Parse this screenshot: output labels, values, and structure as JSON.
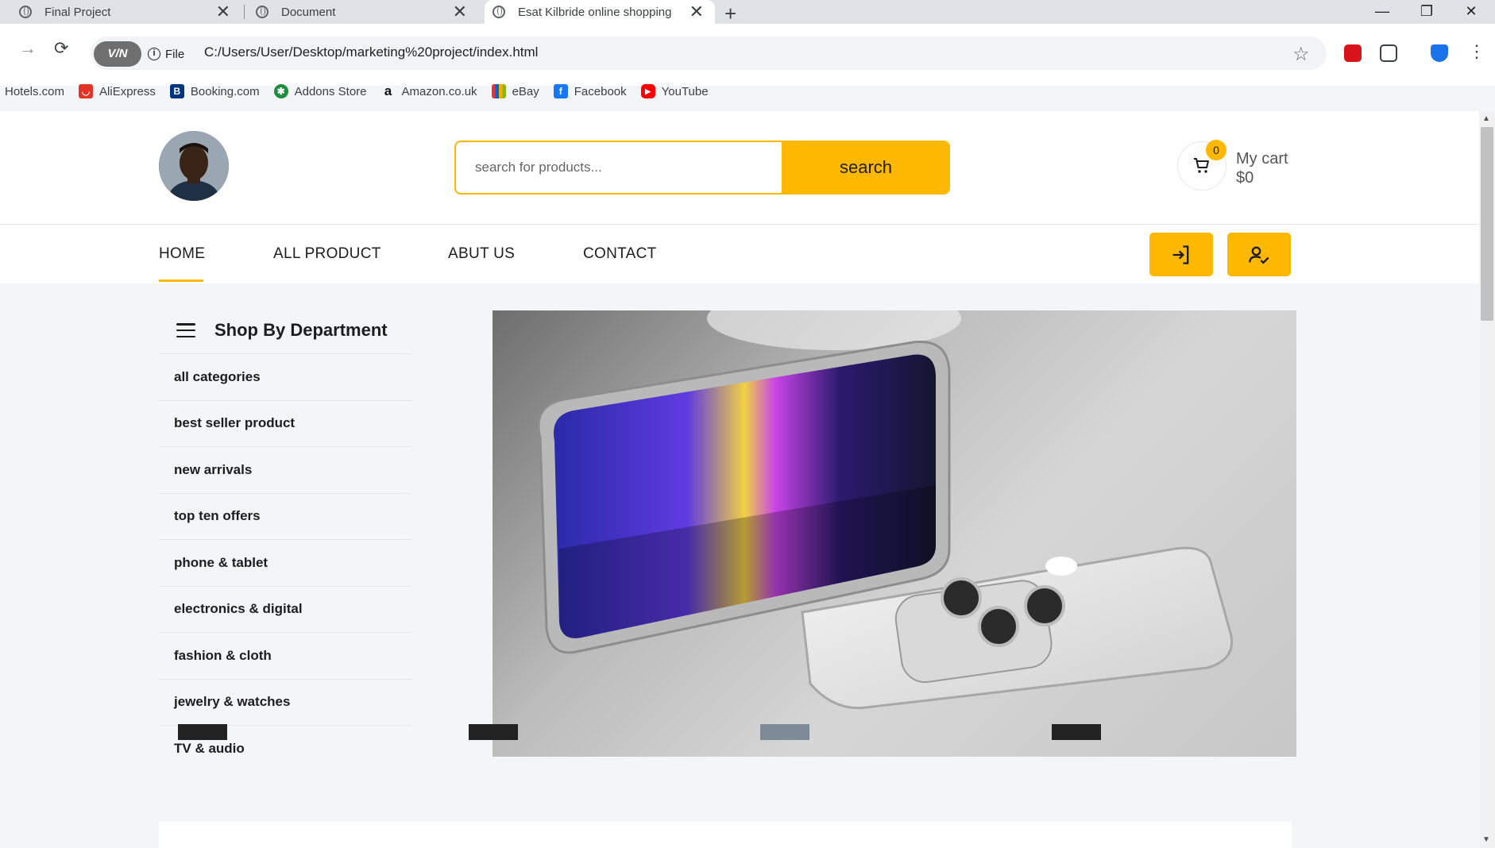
{
  "browser": {
    "tabs": [
      {
        "title": "Final Project",
        "active": false
      },
      {
        "title": "Document",
        "active": false
      },
      {
        "title": "Esat Kilbride online shopping",
        "active": true
      }
    ],
    "vpn_label": "V/N",
    "file_label": "File",
    "url": "C:/Users/User/Desktop/marketing%20project/index.html",
    "bookmarks": [
      {
        "label": "Hotels.com",
        "icon": "none"
      },
      {
        "label": "AliExpress",
        "icon": "aliexpress-icon",
        "color": "#e43225"
      },
      {
        "label": "Booking.com",
        "icon": "booking-icon",
        "color": "#003580",
        "glyph": "B"
      },
      {
        "label": "Addons Store",
        "icon": "addons-icon",
        "color": "#1e8e3e",
        "glyph": "✱"
      },
      {
        "label": "Amazon.co.uk",
        "icon": "amazon-icon",
        "color": "#ffffff",
        "glyph": "a"
      },
      {
        "label": "eBay",
        "icon": "ebay-icon",
        "color": "#e53238"
      },
      {
        "label": "Facebook",
        "icon": "facebook-icon",
        "color": "#1877f2",
        "glyph": "f"
      },
      {
        "label": "YouTube",
        "icon": "youtube-icon",
        "color": "#ff0000",
        "glyph": "▶"
      }
    ]
  },
  "header": {
    "search_placeholder": "search for products...",
    "search_button": "search",
    "cart_count": "0",
    "cart_title": "My cart",
    "cart_total": "$0"
  },
  "nav": {
    "items": [
      "HOME",
      "ALL PRODUCT",
      "ABUT US",
      "CONTACT"
    ],
    "active": "HOME"
  },
  "department": {
    "title": "Shop By Department",
    "items": [
      "all categories",
      "best seller product",
      "new arrivals",
      "top ten offers",
      "phone & tablet",
      "electronics & digital",
      "fashion & cloth",
      "jewelry & watches",
      "TV & audio"
    ]
  },
  "colors": {
    "accent": "#ffb800",
    "text": "#1d1d1d",
    "page_bg": "#f4f5f8"
  }
}
